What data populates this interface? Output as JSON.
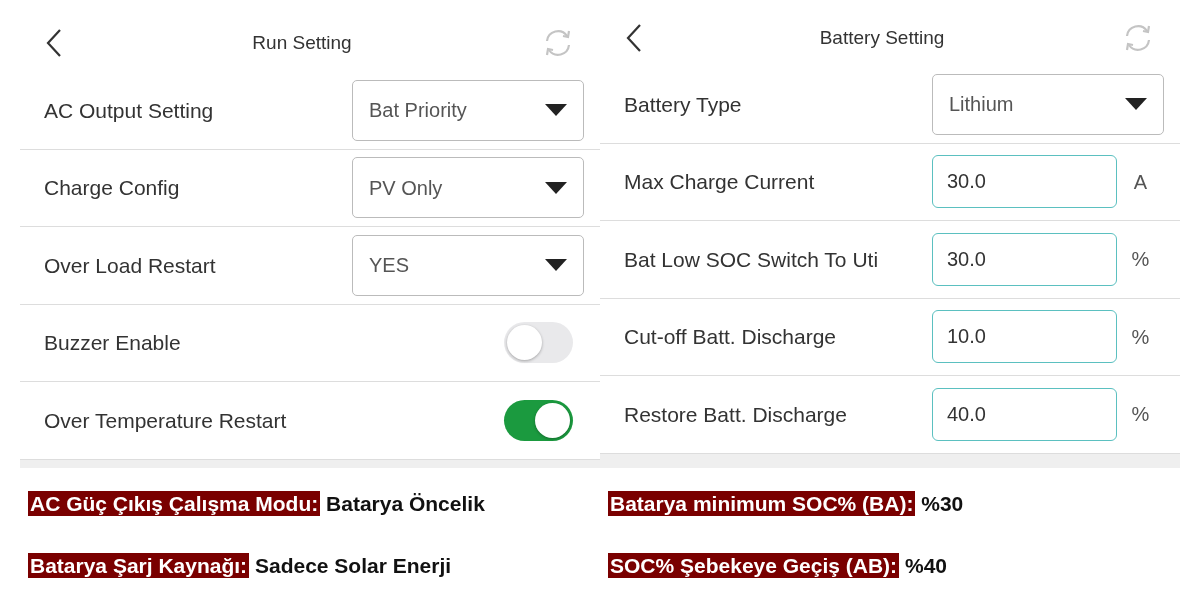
{
  "panels": [
    {
      "title": "Run Setting",
      "rows": [
        {
          "kind": "select",
          "label": "AC Output Setting",
          "value": "Bat Priority"
        },
        {
          "kind": "select",
          "label": "Charge Config",
          "value": "PV Only"
        },
        {
          "kind": "select",
          "label": "Over Load Restart",
          "value": "YES"
        },
        {
          "kind": "toggle",
          "label": "Buzzer Enable",
          "on": false
        },
        {
          "kind": "toggle",
          "label": "Over Temperature Restart",
          "on": true
        }
      ],
      "notes": [
        {
          "label": "AC Güç Çıkış Çalışma Modu:",
          "value": "Batarya Öncelik"
        },
        {
          "label": "Batarya Şarj Kaynağı:",
          "value": "Sadece Solar Enerji"
        }
      ]
    },
    {
      "title": "Battery Setting",
      "rows": [
        {
          "kind": "select",
          "label": "Battery Type",
          "value": "Lithium"
        },
        {
          "kind": "input",
          "label": "Max Charge Current",
          "value": "30.0",
          "unit": "A"
        },
        {
          "kind": "input",
          "label": "Bat Low SOC Switch To Uti",
          "value": "30.0",
          "unit": "%"
        },
        {
          "kind": "input",
          "label": "Cut-off Batt. Discharge",
          "value": "10.0",
          "unit": "%"
        },
        {
          "kind": "input",
          "label": "Restore Batt. Discharge",
          "value": "40.0",
          "unit": "%"
        }
      ],
      "notes": [
        {
          "label": "Batarya minimum SOC% (BA):",
          "value": "%30"
        },
        {
          "label": "SOC% Şebekeye Geçiş (AB):",
          "value": "%40"
        }
      ]
    }
  ]
}
